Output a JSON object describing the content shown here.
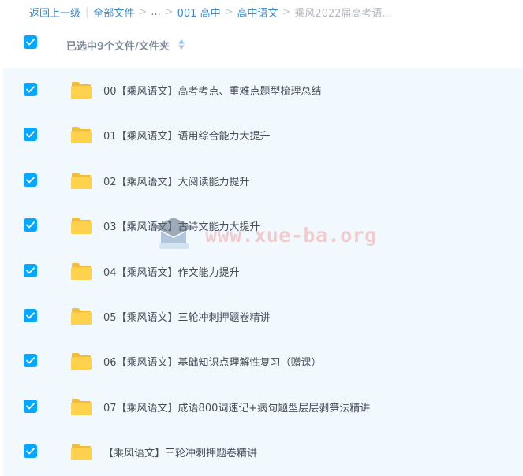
{
  "breadcrumb": {
    "back": "返回上一级",
    "all_files": "全部文件",
    "ellipsis": "...",
    "level1": "001 高中",
    "level2": "高中语文",
    "current": "乘风2022届高考语..."
  },
  "header": {
    "selection_label": "已选中9个文件/文件夹",
    "select_all_checked": true
  },
  "colors": {
    "accent": "#06a7ff",
    "link": "#3b8ccf",
    "folder": "#ffd24e",
    "list_bg": "#f1f9fe"
  },
  "icons": {
    "checkbox": "checked-checkbox-icon",
    "folder": "folder-icon",
    "sort": "sort-icon"
  },
  "watermark": "www.xue-ba.org",
  "files": [
    {
      "name": "00【乘风语文】高考考点、重难点题型梳理总结",
      "checked": true
    },
    {
      "name": "01【乘风语文】语用综合能力大提升",
      "checked": true
    },
    {
      "name": "02【乘风语文】大阅读能力提升",
      "checked": true
    },
    {
      "name": "03【乘风语文】古诗文能力大提升",
      "checked": true
    },
    {
      "name": "04【乘风语文】作文能力提升",
      "checked": true
    },
    {
      "name": "05【乘风语文】三轮冲刺押题卷精讲",
      "checked": true
    },
    {
      "name": "06【乘风语文】基础知识点理解性复习（赠课）",
      "checked": true
    },
    {
      "name": "07【乘风语文】成语800词速记+病句题型层层剥笋法精讲",
      "checked": true
    },
    {
      "name": "【乘风语文】三轮冲刺押题卷精讲",
      "checked": true
    }
  ]
}
